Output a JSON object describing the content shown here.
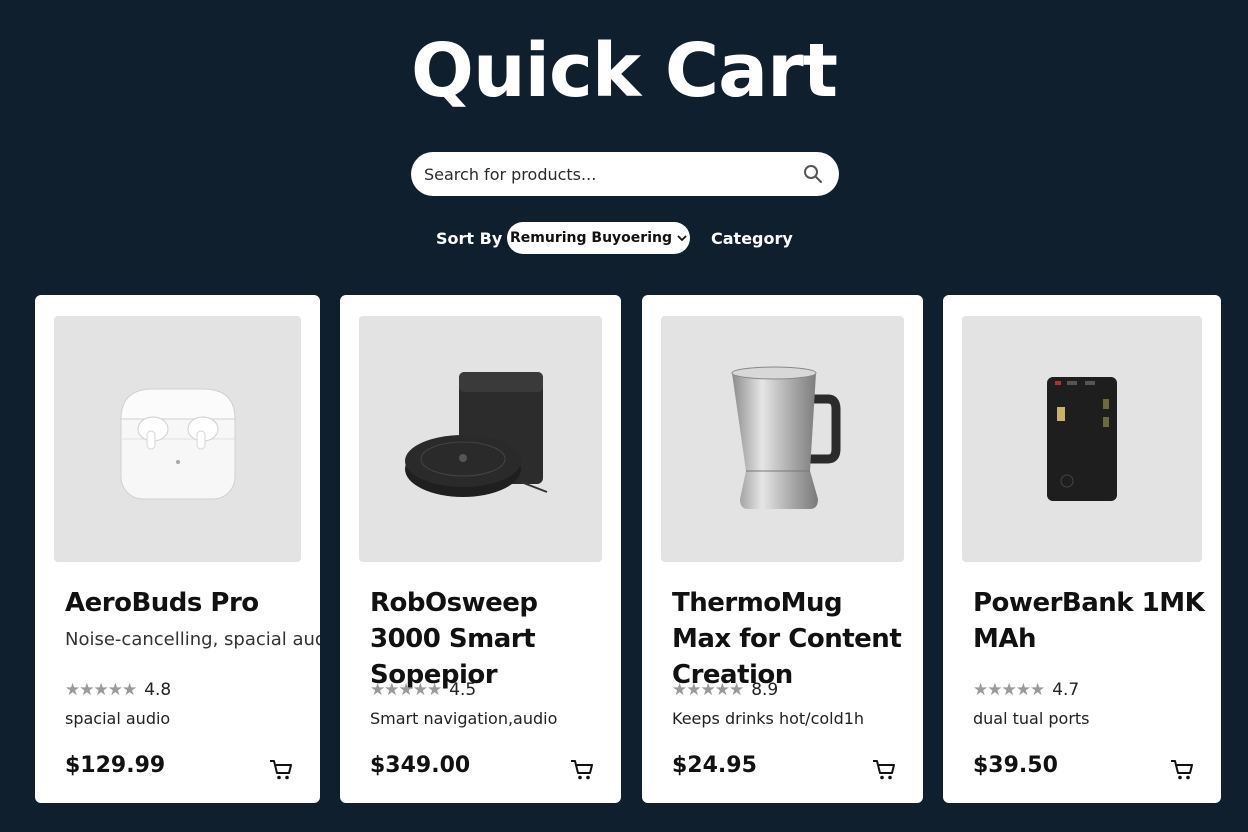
{
  "header": {
    "title": "Quick Cart"
  },
  "search": {
    "placeholder": "Search for products..."
  },
  "filters": {
    "sort_label": "Sort By",
    "sort_value": "Remuring Buyoering",
    "category_label": "Category"
  },
  "products": [
    {
      "name": "AeroBuds Pro",
      "description": "Noise-cancelling, spacial audio",
      "rating": "4.8",
      "feature": "spacial audio",
      "price": "$129.99",
      "image_icon": "earbuds-icon"
    },
    {
      "name": "RobOsweep 3000 Smart Sopepior",
      "description": "",
      "rating": "4.5",
      "feature": "Smart navigation,audio",
      "price": "$349.00",
      "image_icon": "robot-vacuum-icon"
    },
    {
      "name": "ThermoMug Max for Content Creation",
      "description": "",
      "rating": "8.9",
      "feature": "Keeps drinks hot/cold1h",
      "price": "$24.95",
      "image_icon": "travel-mug-icon"
    },
    {
      "name": "PowerBank 1MK MAh",
      "description": "",
      "rating": "4.7",
      "feature": "dual tual ports",
      "price": "$39.50",
      "image_icon": "power-bank-icon"
    }
  ],
  "colors": {
    "background": "#0f1f2d",
    "card": "#ffffff",
    "image_bg": "#e3e3e3",
    "star": "#9a9a9a"
  }
}
